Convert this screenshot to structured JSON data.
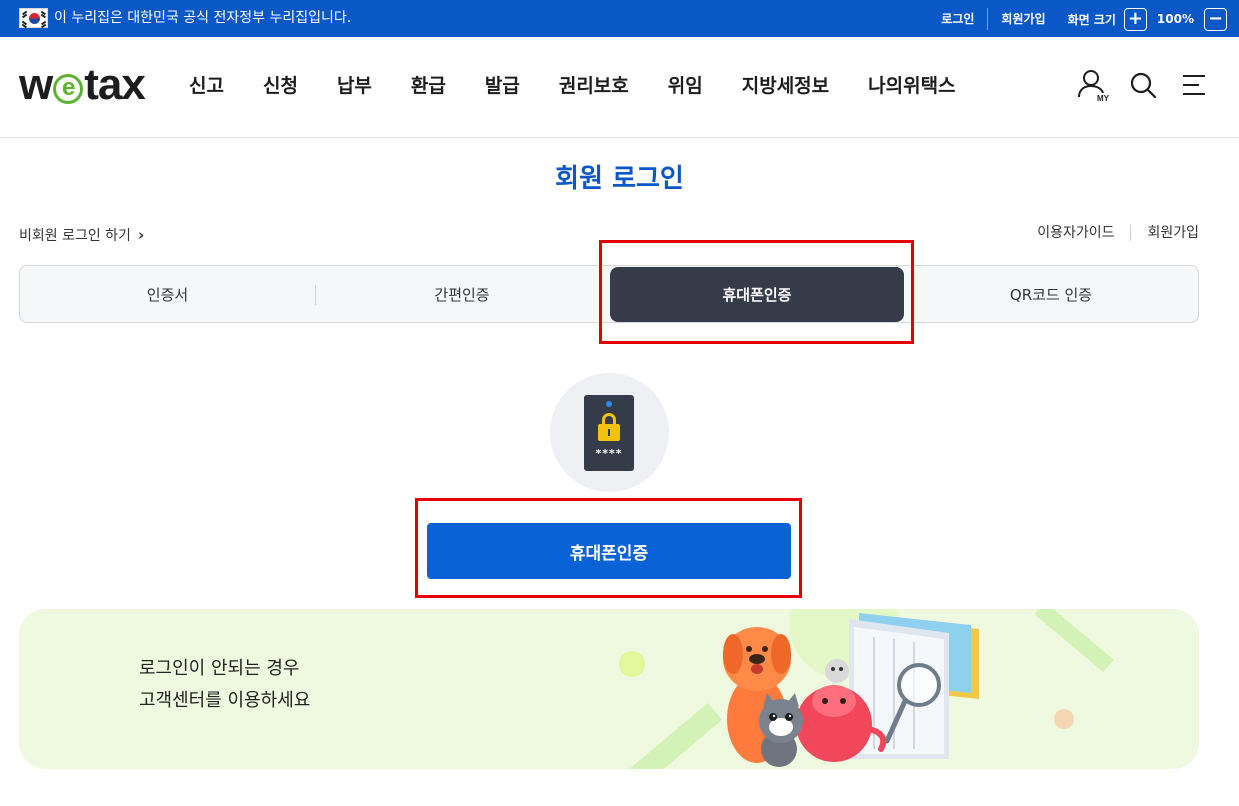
{
  "gov_banner": {
    "text": "이 누리집은 대한민국 공식 전자정부 누리집입니다.",
    "login": "로그인",
    "signup": "회원가입",
    "zoom_label": "화면 크기",
    "zoom_in": "+",
    "zoom_value": "100%",
    "zoom_out": "−"
  },
  "header": {
    "logo_w": "w",
    "logo_e": "e",
    "logo_tax": "tax",
    "nav": [
      "신고",
      "신청",
      "납부",
      "환급",
      "발급",
      "권리보호",
      "위임",
      "지방세정보",
      "나의위택스"
    ],
    "icons": [
      "my-page-icon",
      "search-icon",
      "menu-icon"
    ]
  },
  "page": {
    "title": "회원 로그인",
    "nonmember_login": "비회원 로그인 하기",
    "user_guide": "이용자가이드",
    "signup": "회원가입"
  },
  "tabs": [
    {
      "label": "인증서",
      "active": false
    },
    {
      "label": "간편인증",
      "active": false
    },
    {
      "label": "휴대폰인증",
      "active": true
    },
    {
      "label": "QR코드 인증",
      "active": false
    }
  ],
  "phone_illustration": {
    "icon": "phone-lock-icon",
    "masked_code": "****"
  },
  "auth_button": {
    "label": "휴대폰인증"
  },
  "help_banner": {
    "line1": "로그인이 안되는 경우",
    "line2": "고객센터를 이용하세요"
  },
  "colors": {
    "brand_blue": "#0a58c8",
    "button_blue": "#0a63d6",
    "active_tab": "#363b4a",
    "logo_green": "#5cb332",
    "highlight_red": "#e50000",
    "banner_bg": "#eff9df"
  }
}
